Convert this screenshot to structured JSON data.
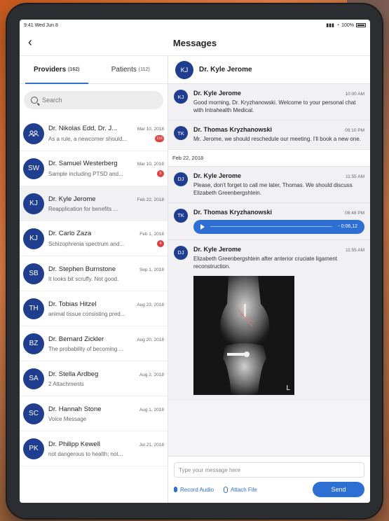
{
  "status_bar": {
    "time": "9:41",
    "date": "Wed Jun 8",
    "battery": "100%"
  },
  "nav": {
    "back_icon": "chevron-left-icon",
    "title": "Messages"
  },
  "tabs": [
    {
      "label": "Providers",
      "count": "(162)"
    },
    {
      "label": "Patients",
      "count": "(112)"
    }
  ],
  "search": {
    "placeholder": "Search"
  },
  "contacts": [
    {
      "initials": "",
      "icon": "group-icon",
      "name": "Dr. Nikolas Edd, Dr. J...",
      "date": "Mar 10, 2018",
      "preview": "As a rule, a newcomer should...",
      "badge": "116"
    },
    {
      "initials": "SW",
      "name": "Dr. Samuel Westerberg",
      "date": "Mar 10, 2018",
      "preview": "Sample including PTSD and...",
      "badge": "5"
    },
    {
      "initials": "KJ",
      "name": "Dr. Kyle Jerome",
      "date": "Feb 22, 2018",
      "preview": "Reapplication for benefits ...",
      "badge": ""
    },
    {
      "initials": "KJ",
      "name": "Dr. Carlo Zaza",
      "date": "Feb 1, 2018",
      "preview": "Schizophrenia spectrum and...",
      "badge": "4"
    },
    {
      "initials": "SB",
      "name": "Dr. Stephen Burnstone",
      "date": "Sep 1, 2018",
      "preview": "It looks bit scruffy. Not good.",
      "badge": ""
    },
    {
      "initials": "TH",
      "name": "Dr. Tobias Hitzel",
      "date": "Aug 23, 2018",
      "preview": "animal tissue consisting pred...",
      "badge": ""
    },
    {
      "initials": "BZ",
      "name": "Dr. Bernard Zickler",
      "date": "Aug 20, 2018",
      "preview": "The probability of becoming ...",
      "badge": ""
    },
    {
      "initials": "SA",
      "name": "Dr. Stella Ardbeg",
      "date": "Aug 2, 2018",
      "preview": "2 Attachments",
      "badge": ""
    },
    {
      "initials": "SC",
      "name": "Dr. Hannah Stone",
      "date": "Aug 1, 2018",
      "preview": "Voice Message",
      "badge": ""
    },
    {
      "initials": "PK",
      "name": "Dr. Philipp Kewell",
      "date": "Jul 21, 2018",
      "preview": "not dangerous to health; not...",
      "badge": ""
    }
  ],
  "chat": {
    "header": {
      "initials": "KJ",
      "name": "Dr. Kyle Jerome"
    },
    "messages": [
      {
        "initials": "KJ",
        "name": "Dr. Kyle Jerome",
        "time": "10:00 AM",
        "text": "Good morning, Dr. Kryzhanowski. Welcome to your personal chat with Intrahealth Medical."
      },
      {
        "initials": "TK",
        "name": "Dr. Thomas Kryzhanowski",
        "time": "09:10 PM",
        "text": "Mr. Jerome, we should reschedule our meeting. I'll book a new one."
      }
    ],
    "date_separator": "Feb 22, 2018",
    "messages2": [
      {
        "initials": "DJ",
        "name": "Dr. Kyle Jerome",
        "time": "11:55 AM",
        "text": "Please, don't forget to call me later, Thomas. We should discuss Elizabeth Greenbergshtein."
      },
      {
        "initials": "TK",
        "name": "Dr. Thomas Kryzhanowski",
        "time": "08:48 PM",
        "audio_time": "- 0:06,12"
      },
      {
        "initials": "DJ",
        "name": "Dr. Kyle Jerome",
        "time": "11:55 AM",
        "text": "Elizabeth Greenbergshtein after anterior cruciate ligament reconstruction.",
        "image_label": "L"
      }
    ]
  },
  "composer": {
    "placeholder": "Type your message here",
    "record_label": "Record Audio",
    "attach_label": "Attach File",
    "send_label": "Send"
  },
  "colors": {
    "accent": "#2d6fd3",
    "avatar": "#1f3e8f",
    "badge": "#e04040"
  }
}
